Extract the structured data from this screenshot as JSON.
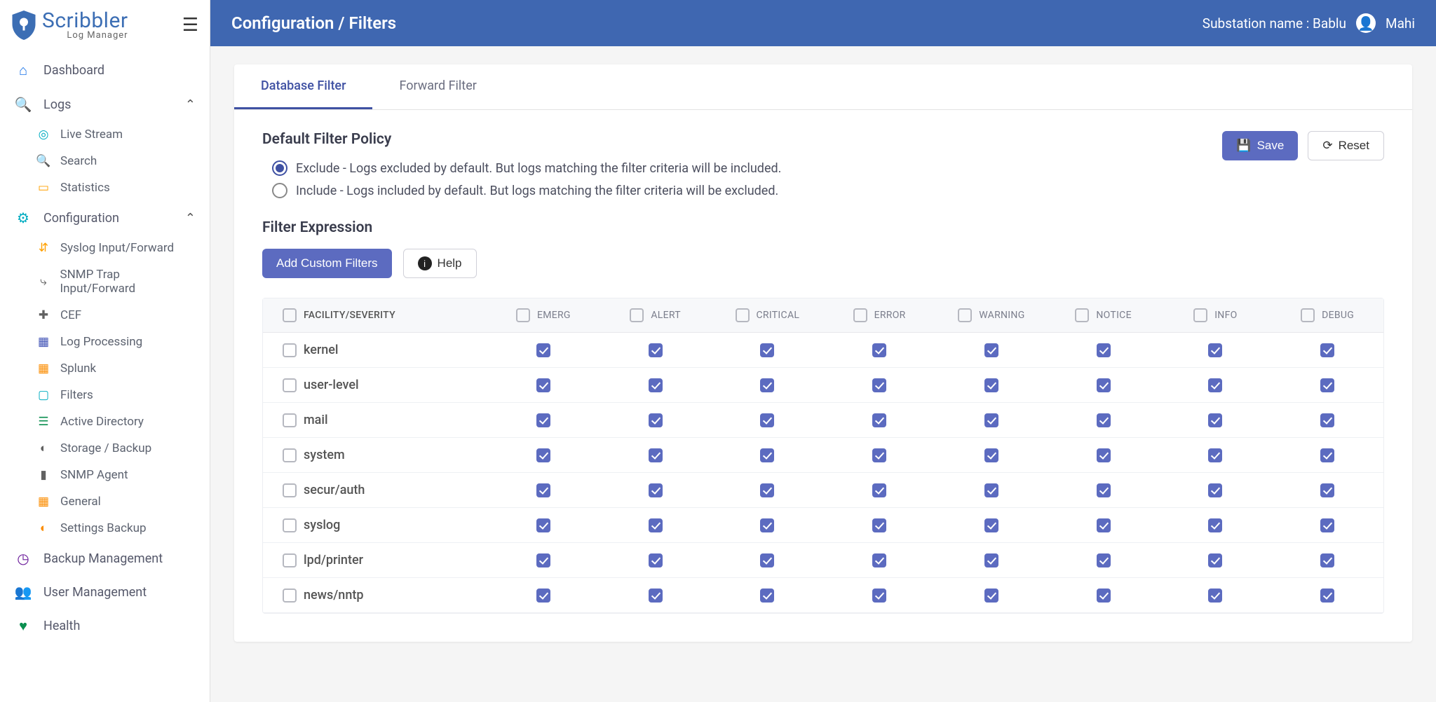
{
  "app": {
    "name": "Scribbler",
    "tagline": "Log Manager"
  },
  "header": {
    "breadcrumb": "Configuration / Filters",
    "substation_label": "Substation name : Bablu",
    "user": "Mahi"
  },
  "sidebar": {
    "dashboard": "Dashboard",
    "logs": {
      "label": "Logs",
      "items": [
        "Live Stream",
        "Search",
        "Statistics"
      ]
    },
    "config": {
      "label": "Configuration",
      "items": [
        "Syslog Input/Forward",
        "SNMP Trap Input/Forward",
        "CEF",
        "Log Processing",
        "Splunk",
        "Filters",
        "Active Directory",
        "Storage / Backup",
        "SNMP Agent",
        "General",
        "Settings Backup"
      ]
    },
    "backup_mgmt": "Backup Management",
    "user_mgmt": "User Management",
    "health": "Health"
  },
  "tabs": [
    "Database Filter",
    "Forward Filter"
  ],
  "active_tab": 0,
  "buttons": {
    "save": "Save",
    "reset": "Reset",
    "add_custom": "Add Custom Filters",
    "help": "Help"
  },
  "policy": {
    "title": "Default Filter Policy",
    "selected": 0,
    "options": [
      "Exclude - Logs excluded by default. But logs matching the filter criteria will be included.",
      "Include - Logs included by default. But logs matching the filter criteria will be excluded."
    ]
  },
  "expression": {
    "title": "Filter Expression"
  },
  "table": {
    "header_first": "FACILITY/SEVERITY",
    "severities": [
      "EMERG",
      "ALERT",
      "CRITICAL",
      "ERROR",
      "WARNING",
      "NOTICE",
      "INFO",
      "DEBUG"
    ],
    "facilities": [
      "kernel",
      "user-level",
      "mail",
      "system",
      "secur/auth",
      "syslog",
      "lpd/printer",
      "news/nntp"
    ]
  }
}
